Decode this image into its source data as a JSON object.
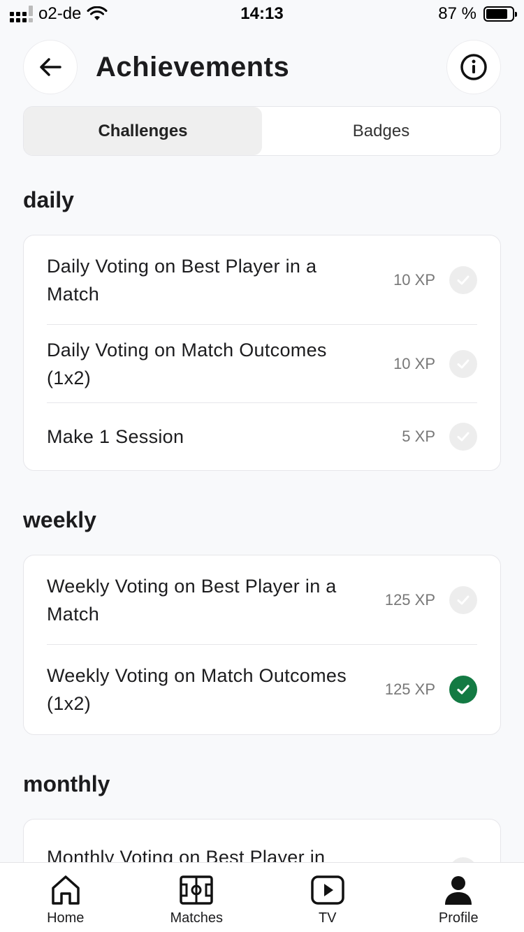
{
  "status_bar": {
    "carrier": "o2-de",
    "time": "14:13",
    "battery": "87 %"
  },
  "header": {
    "title": "Achievements"
  },
  "tabs": [
    {
      "label": "Challenges",
      "active": true
    },
    {
      "label": "Badges",
      "active": false
    }
  ],
  "sections": {
    "daily": {
      "title": "daily",
      "items": [
        {
          "label": "Daily Voting on Best Player in a Match",
          "xp": "10 XP",
          "completed": false
        },
        {
          "label": "Daily Voting on Match Outcomes (1x2)",
          "xp": "10 XP",
          "completed": false
        },
        {
          "label": "Make 1 Session",
          "xp": "5 XP",
          "completed": false
        }
      ]
    },
    "weekly": {
      "title": "weekly",
      "items": [
        {
          "label": "Weekly Voting on Best Player in a Match",
          "xp": "125 XP",
          "completed": false
        },
        {
          "label": "Weekly Voting on Match Outcomes (1x2)",
          "xp": "125 XP",
          "completed": true
        }
      ]
    },
    "monthly": {
      "title": "monthly",
      "items": [
        {
          "label": "Monthly Voting on Best Player in",
          "xp": "",
          "completed": false
        }
      ]
    }
  },
  "bottom_nav": [
    {
      "label": "Home",
      "icon": "home-icon"
    },
    {
      "label": "Matches",
      "icon": "pitch-icon"
    },
    {
      "label": "TV",
      "icon": "play-icon"
    },
    {
      "label": "Profile",
      "icon": "profile-icon"
    }
  ],
  "colors": {
    "accent_completed": "#137a43",
    "background": "#f8f9fb"
  }
}
